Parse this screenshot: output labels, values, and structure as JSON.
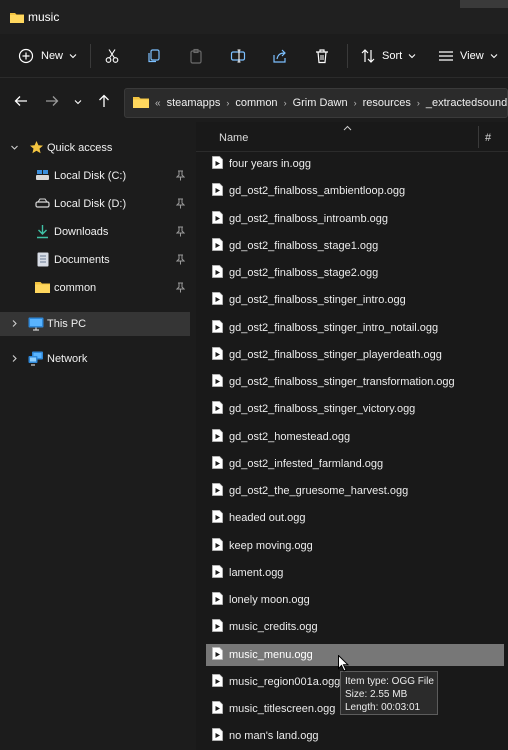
{
  "window": {
    "title": "music"
  },
  "toolbar": {
    "new_label": "New",
    "sort_label": "Sort",
    "view_label": "View"
  },
  "breadcrumb": [
    "steamapps",
    "common",
    "Grim Dawn",
    "resources",
    "_extractedsound"
  ],
  "nav": {
    "quick_access": "Quick access",
    "items": [
      {
        "label": "Local Disk (C:)",
        "icon": "drive-icon"
      },
      {
        "label": "Local Disk (D:)",
        "icon": "drive-icon"
      },
      {
        "label": "Downloads",
        "icon": "download-icon"
      },
      {
        "label": "Documents",
        "icon": "document-icon"
      },
      {
        "label": "common",
        "icon": "folder-icon"
      }
    ],
    "this_pc": "This PC",
    "network": "Network"
  },
  "columns": {
    "name": "Name",
    "number": "#"
  },
  "files": [
    "four years in.ogg",
    "gd_ost2_finalboss_ambientloop.ogg",
    "gd_ost2_finalboss_introamb.ogg",
    "gd_ost2_finalboss_stage1.ogg",
    "gd_ost2_finalboss_stage2.ogg",
    "gd_ost2_finalboss_stinger_intro.ogg",
    "gd_ost2_finalboss_stinger_intro_notail.ogg",
    "gd_ost2_finalboss_stinger_playerdeath.ogg",
    "gd_ost2_finalboss_stinger_transformation.ogg",
    "gd_ost2_finalboss_stinger_victory.ogg",
    "gd_ost2_homestead.ogg",
    "gd_ost2_infested_farmland.ogg",
    "gd_ost2_the_gruesome_harvest.ogg",
    "headed out.ogg",
    "keep moving.ogg",
    "lament.ogg",
    "lonely moon.ogg",
    "music_credits.ogg",
    "music_menu.ogg",
    "music_region001a.ogg",
    "music_titlescreen.ogg",
    "no man's land.ogg"
  ],
  "selected_file": "music_menu.ogg",
  "tooltip": {
    "type": "Item type: OGG File",
    "size": "Size: 2.55 MB",
    "length": "Length: 00:03:01"
  }
}
